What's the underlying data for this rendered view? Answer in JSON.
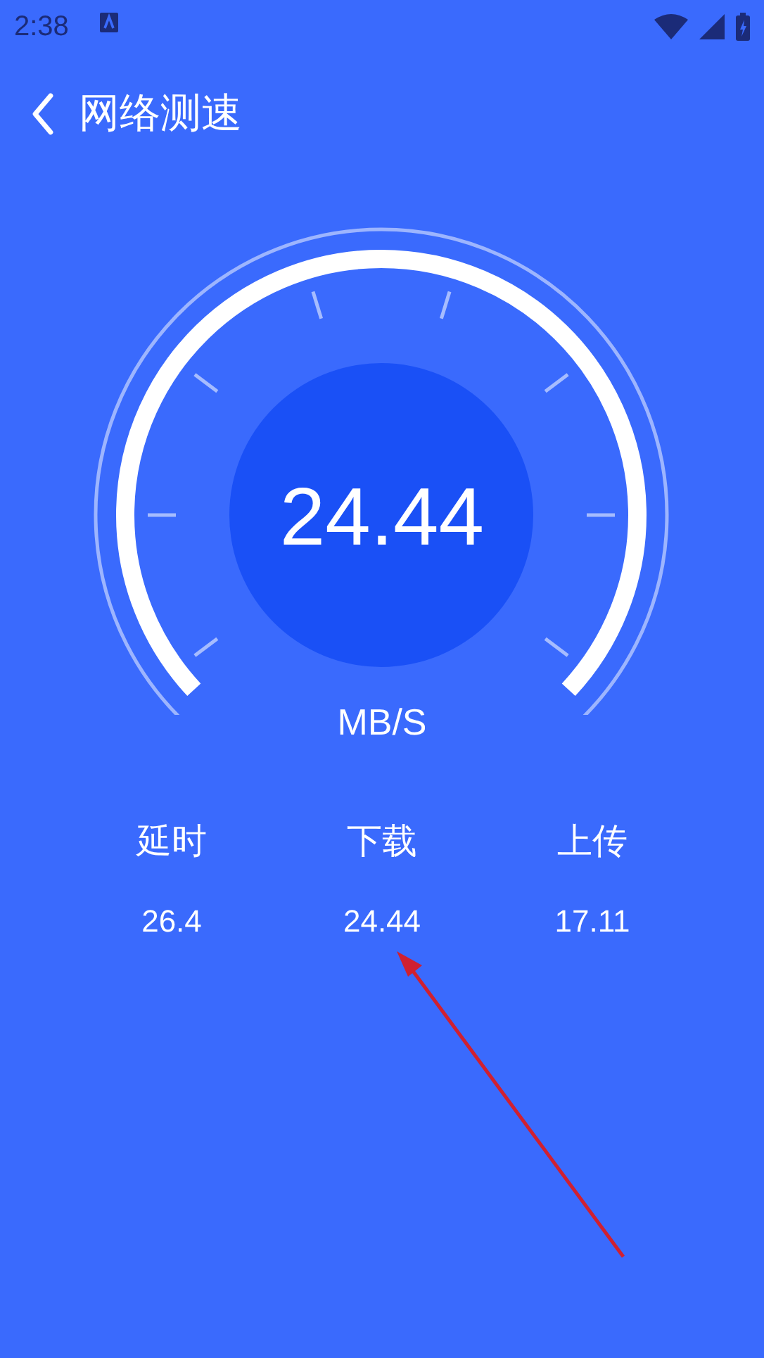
{
  "status_bar": {
    "time": "2:38"
  },
  "header": {
    "title": "网络测速"
  },
  "gauge": {
    "value": "24.44",
    "unit": "MB/S"
  },
  "stats": [
    {
      "label": "延时",
      "value": "26.4"
    },
    {
      "label": "下载",
      "value": "24.44"
    },
    {
      "label": "上传",
      "value": "17.11"
    }
  ]
}
